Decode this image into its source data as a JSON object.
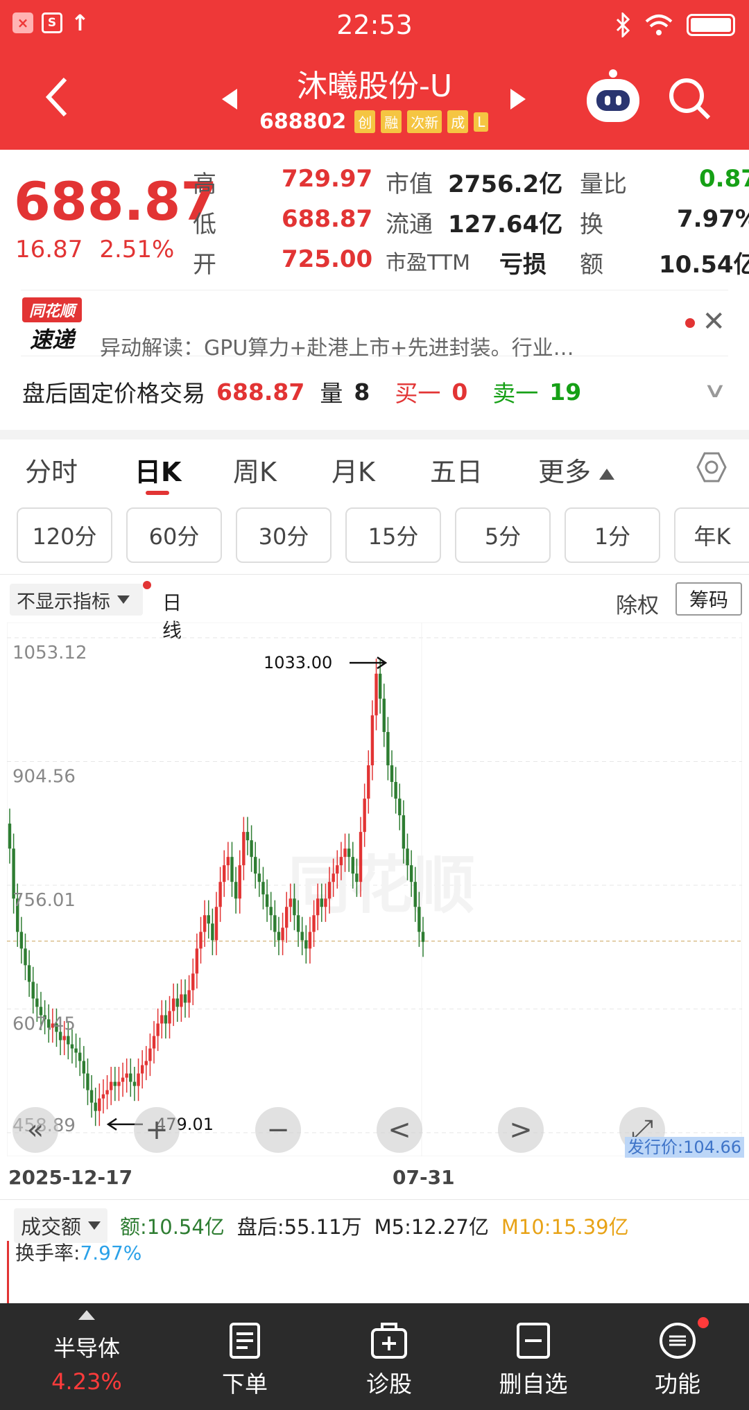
{
  "status_bar": {
    "time": "22:53",
    "left_badges": [
      "×",
      "S",
      "↑"
    ]
  },
  "header": {
    "title": "沐曦股份-U",
    "code": "688802",
    "tags": [
      "创",
      "融",
      "次新",
      "成",
      "L"
    ]
  },
  "quote": {
    "price": "688.87",
    "change": "16.87",
    "change_pct": "2.51%",
    "cells": [
      {
        "label": "高",
        "value": "729.97"
      },
      {
        "label": "低",
        "value": "688.87"
      },
      {
        "label": "开",
        "value": "725.00"
      },
      {
        "label": "市值",
        "value": "2756.2亿"
      },
      {
        "label": "流通",
        "value": "127.64亿"
      },
      {
        "label": "市盈TTM",
        "value": "亏损"
      },
      {
        "label": "量比",
        "value": "0.87"
      },
      {
        "label": "换",
        "value": "7.97%"
      },
      {
        "label": "额",
        "value": "10.54亿"
      }
    ]
  },
  "news": {
    "logo_top": "同花顺",
    "logo_bottom": "速递",
    "text": "异动解读：GPU算力+赴港上市+先进封装。行业…"
  },
  "after_hours": {
    "label": "盘后固定价格交易",
    "price": "688.87",
    "vol_label": "量",
    "vol": "8",
    "buy_label": "买一",
    "buy": "0",
    "sell_label": "卖一",
    "sell": "19"
  },
  "period_tabs": [
    "分时",
    "日K",
    "周K",
    "月K",
    "五日",
    "更多"
  ],
  "active_tab": "日K",
  "minute_buttons": [
    "120分",
    "60分",
    "30分",
    "15分",
    "5分",
    "1分",
    "年K"
  ],
  "indicator": {
    "select": "不显示指标",
    "line": "日线",
    "chuquan": "除权",
    "chouma": "筹码"
  },
  "chart_data": {
    "type": "candlestick",
    "y_tick_labels": [
      "1053.12",
      "904.56",
      "756.01",
      "607.45",
      "458.89"
    ],
    "ylim": [
      458.89,
      1053.12
    ],
    "x_tick_labels": [
      "2025-12-17",
      "07-31"
    ],
    "max_label": "1033.00",
    "min_label": "479.01",
    "reference_line": 688.87,
    "issue_price_label": "发行价:104.66",
    "watermark": "同花顺",
    "close_series": [
      800,
      740,
      700,
      680,
      660,
      640,
      620,
      610,
      600,
      595,
      585,
      590,
      580,
      570,
      575,
      565,
      560,
      555,
      545,
      530,
      510,
      495,
      485,
      500,
      505,
      510,
      520,
      515,
      520,
      525,
      530,
      520,
      515,
      530,
      540,
      545,
      560,
      575,
      590,
      600,
      590,
      605,
      620,
      610,
      625,
      615,
      630,
      650,
      680,
      700,
      720,
      710,
      690,
      730,
      760,
      780,
      790,
      760,
      740,
      780,
      820,
      810,
      790,
      770,
      760,
      745,
      730,
      720,
      700,
      690,
      705,
      730,
      740,
      720,
      700,
      690,
      680,
      700,
      720,
      740,
      730,
      740,
      760,
      770,
      780,
      790,
      800,
      790,
      770,
      760,
      820,
      860,
      900,
      960,
      1010,
      980,
      940,
      900,
      880,
      860,
      840,
      800,
      780,
      760,
      730,
      700,
      688
    ]
  },
  "chart_controls": [
    "«",
    "+",
    "−",
    "<",
    ">",
    "⤢"
  ],
  "volume": {
    "select": "成交额",
    "amount": "额:10.54亿",
    "after": "盘后:55.11万",
    "m5": "M5:12.27亿",
    "m10": "M10:15.39亿",
    "turnover_label": "换手率:",
    "turnover_value": "7.97%"
  },
  "bottom_nav": {
    "sector_name": "半导体",
    "sector_pct": "4.23%",
    "items": [
      "下单",
      "诊股",
      "删自选",
      "功能"
    ]
  },
  "colors": {
    "accent_red": "#ee3838",
    "up_red": "#e23434",
    "down_green": "#2e7d32"
  }
}
